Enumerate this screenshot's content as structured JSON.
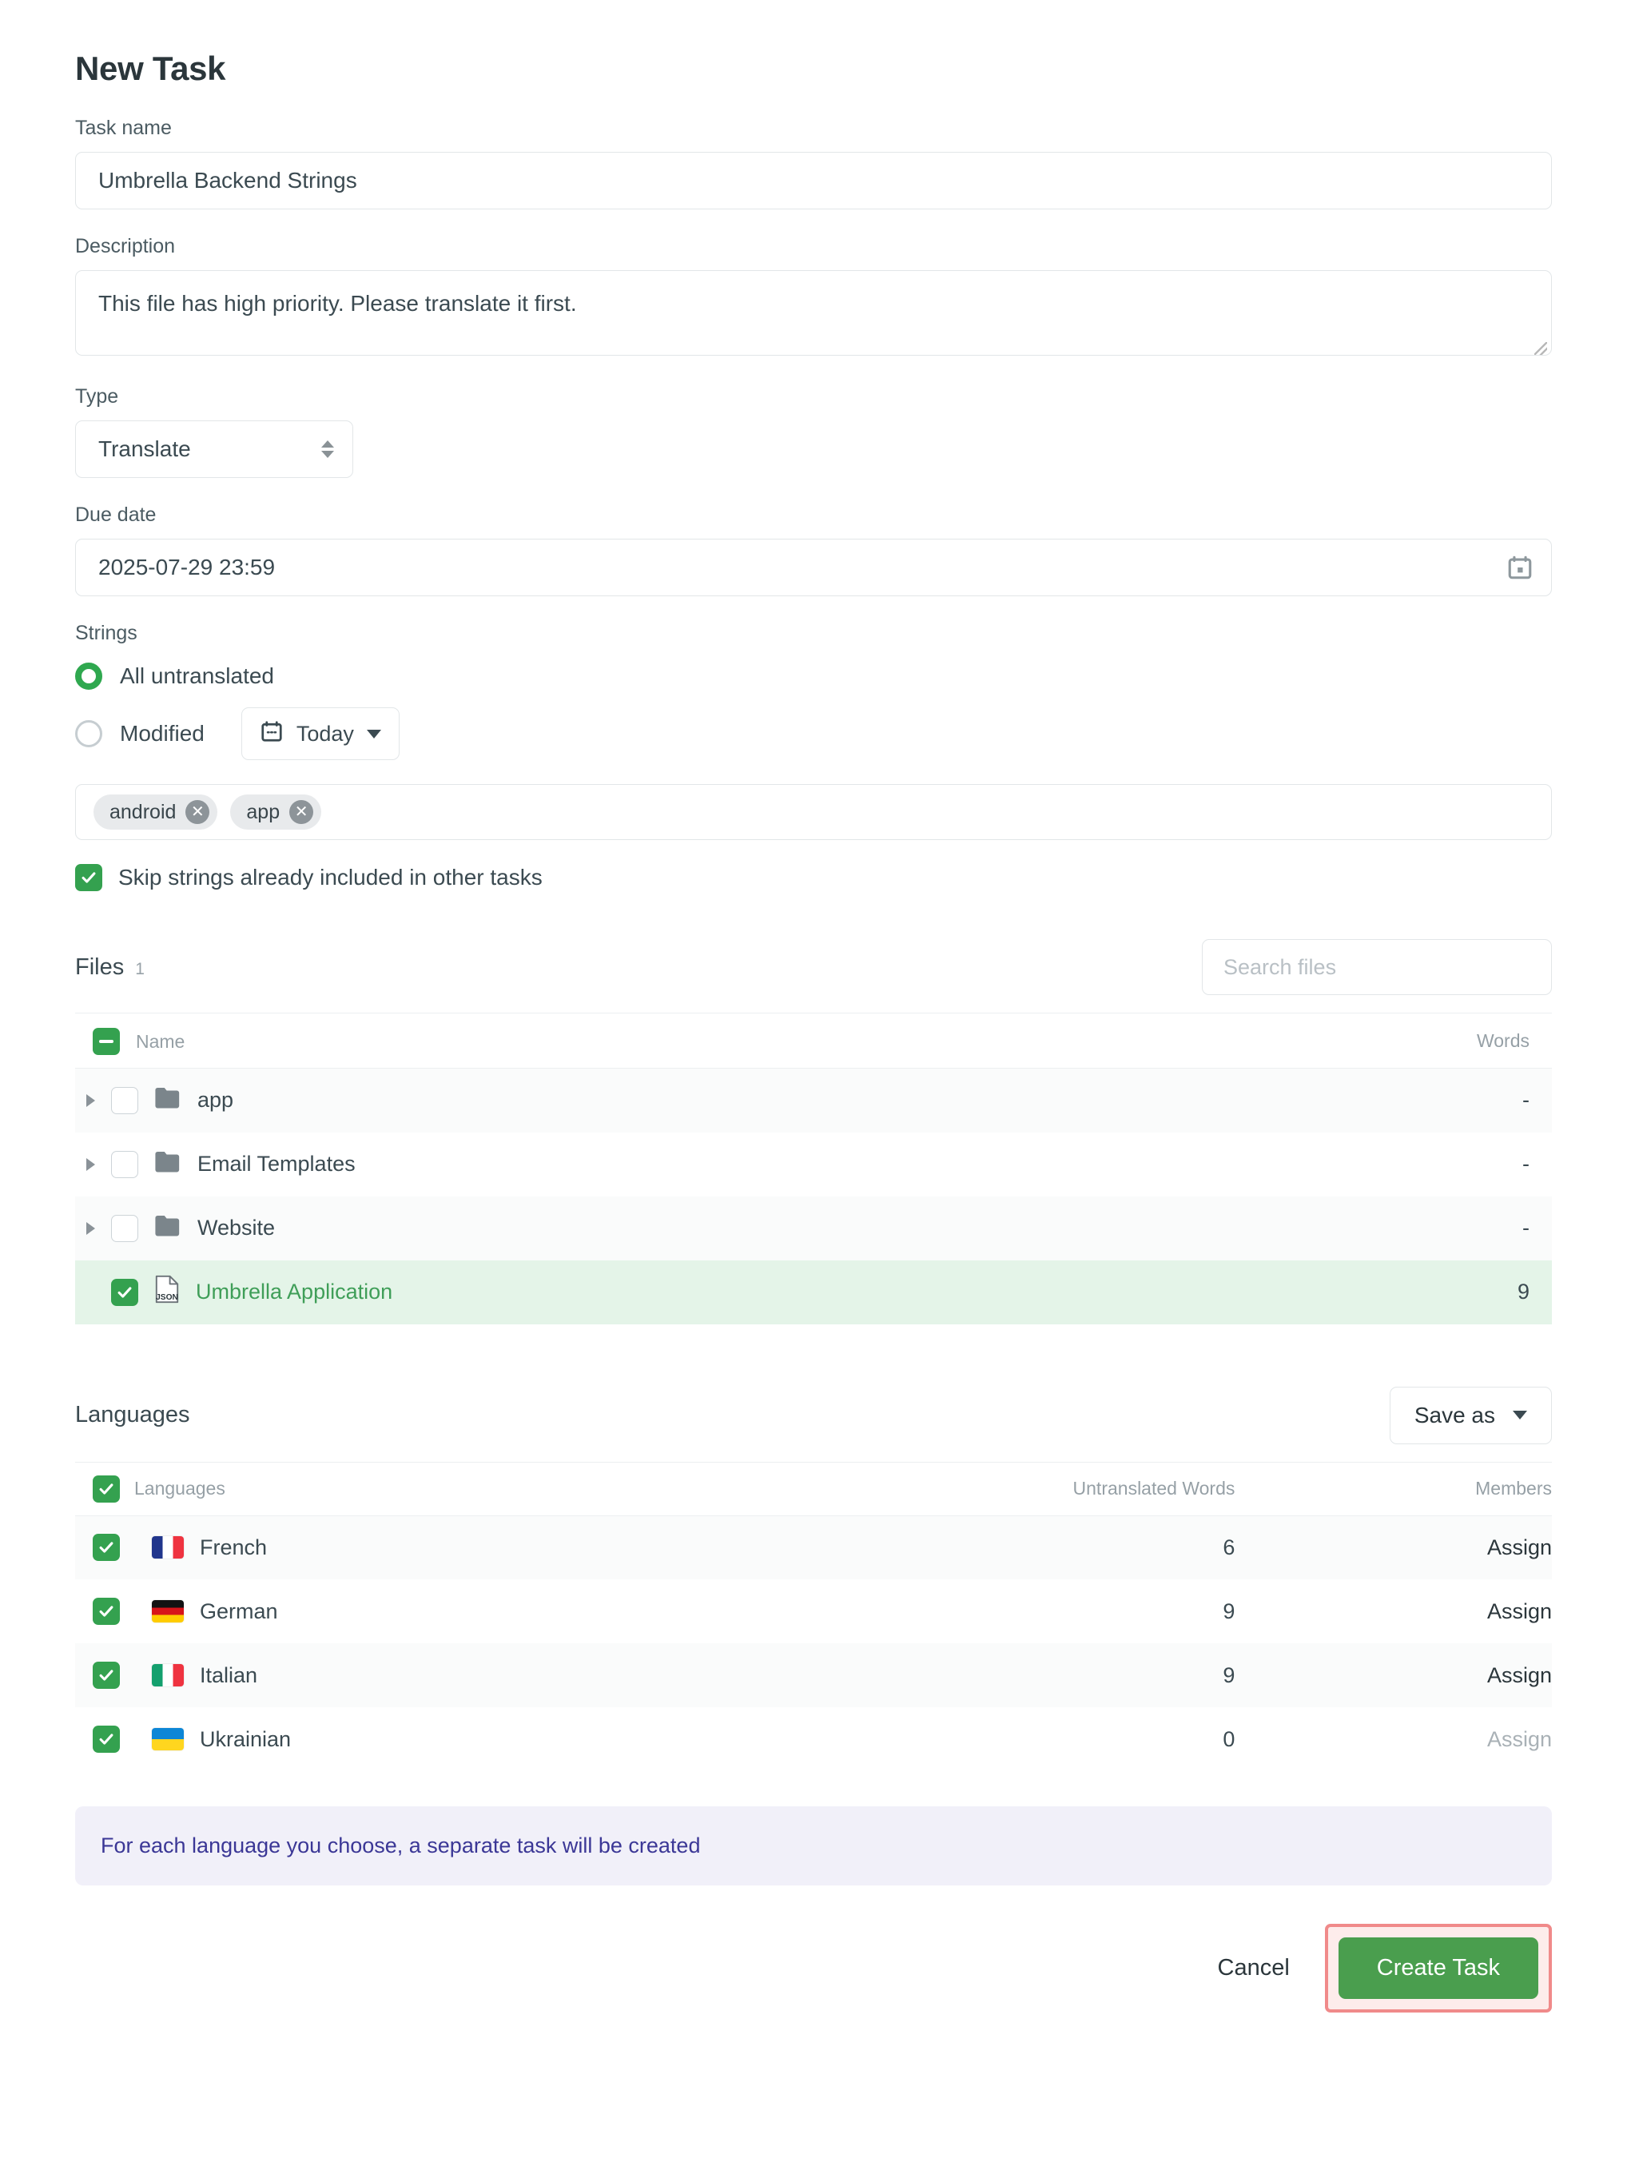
{
  "title": "New Task",
  "fields": {
    "task_name_label": "Task name",
    "task_name_value": "Umbrella Backend Strings",
    "task_name_placeholder": "Task name",
    "description_label": "Description",
    "description_value": "This file has high priority. Please translate it first.",
    "description_placeholder": "Description",
    "type_label": "Type",
    "type_value": "Translate",
    "due_date_label": "Due date",
    "due_date_value": "2025-07-29 23:59"
  },
  "strings": {
    "label": "Strings",
    "option_all_label": "All untranslated",
    "option_all_selected": true,
    "option_modified_label": "Modified",
    "option_modified_selected": false,
    "modified_date_value": "Today",
    "tags": [
      "android",
      "app"
    ],
    "skip_label": "Skip strings already included in other tasks",
    "skip_checked": true
  },
  "files": {
    "title": "Files",
    "count": "1",
    "search_placeholder": "Search files",
    "search_value": "",
    "columns": {
      "name": "Name",
      "words": "Words"
    },
    "header_checkbox_state": "indeterminate",
    "rows": [
      {
        "name": "app",
        "type": "folder",
        "checked": false,
        "expandable": true,
        "words": "-",
        "selected": false
      },
      {
        "name": "Email Templates",
        "type": "folder",
        "checked": false,
        "expandable": true,
        "words": "-",
        "selected": false
      },
      {
        "name": "Website",
        "type": "folder",
        "checked": false,
        "expandable": true,
        "words": "-",
        "selected": false
      },
      {
        "name": "Umbrella Application",
        "type": "json",
        "checked": true,
        "expandable": false,
        "words": "9",
        "selected": true
      }
    ]
  },
  "languages": {
    "title": "Languages",
    "save_as_label": "Save as",
    "header_checkbox_checked": true,
    "columns": {
      "languages": "Languages",
      "untranslated_words": "Untranslated Words",
      "members": "Members"
    },
    "rows": [
      {
        "name": "French",
        "flag": "flag-fr",
        "checked": true,
        "untranslated_words": "6",
        "members_action": "Assign",
        "members_muted": false
      },
      {
        "name": "German",
        "flag": "flag-de",
        "checked": true,
        "untranslated_words": "9",
        "members_action": "Assign",
        "members_muted": false
      },
      {
        "name": "Italian",
        "flag": "flag-it",
        "checked": true,
        "untranslated_words": "9",
        "members_action": "Assign",
        "members_muted": false
      },
      {
        "name": "Ukrainian",
        "flag": "flag-ua",
        "checked": true,
        "untranslated_words": "0",
        "members_action": "Assign",
        "members_muted": true
      }
    ]
  },
  "info_banner": "For each language you choose, a separate task will be created",
  "footer": {
    "cancel_label": "Cancel",
    "create_label": "Create Task"
  },
  "colors": {
    "accent_green": "#34a14f",
    "primary_button": "#4a9e4e",
    "selected_row": "#e4f4e8",
    "banner_bg": "#f1f0f9",
    "banner_text": "#3b3796",
    "highlight_border": "#f08a8a"
  }
}
